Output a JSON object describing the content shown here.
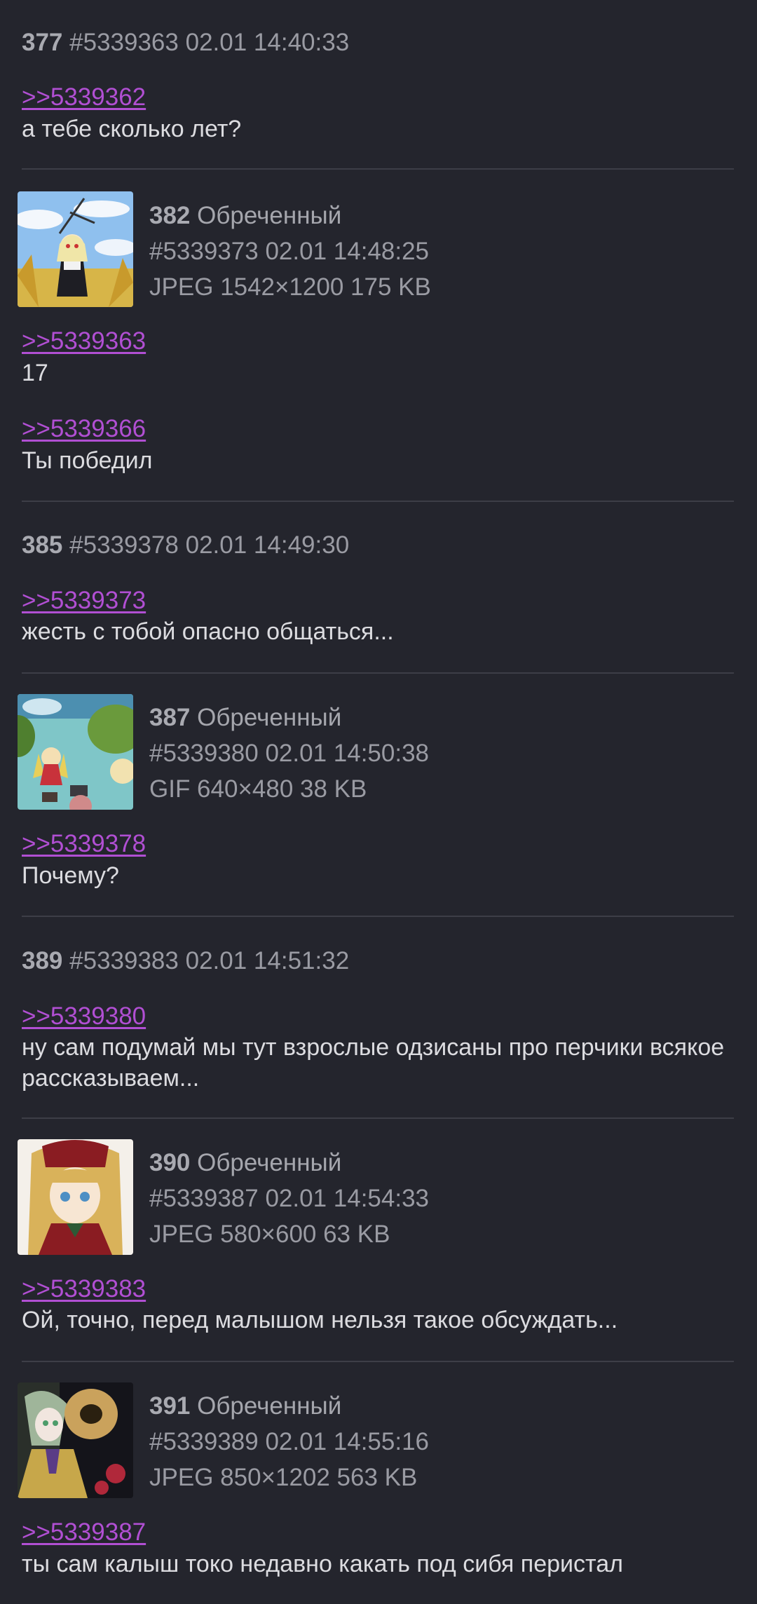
{
  "posts": [
    {
      "num": "377",
      "id": "#5339363",
      "date": "02.01 14:40:33",
      "replies": [
        {
          "link": ">>5339362",
          "text": "а тебе сколько лет?"
        }
      ]
    },
    {
      "num": "382",
      "name": "Обреченный",
      "id": "#5339373",
      "date": "02.01 14:48:25",
      "file": "JPEG 1542×1200 175 KB",
      "replies": [
        {
          "link": ">>5339363",
          "text": "17"
        },
        {
          "link": ">>5339366",
          "text": "Ты победил"
        }
      ]
    },
    {
      "num": "385",
      "id": "#5339378",
      "date": "02.01 14:49:30",
      "replies": [
        {
          "link": ">>5339373",
          "text": "жесть с тобой опасно общаться..."
        }
      ]
    },
    {
      "num": "387",
      "name": "Обреченный",
      "id": "#5339380",
      "date": "02.01 14:50:38",
      "file": "GIF 640×480 38 KB",
      "replies": [
        {
          "link": ">>5339378",
          "text": "Почему?"
        }
      ]
    },
    {
      "num": "389",
      "id": "#5339383",
      "date": "02.01 14:51:32",
      "replies": [
        {
          "link": ">>5339380",
          "text": "ну сам подумай мы тут взрослые одзисаны про перчики всякое рассказываем..."
        }
      ]
    },
    {
      "num": "390",
      "name": "Обреченный",
      "id": "#5339387",
      "date": "02.01 14:54:33",
      "file": "JPEG 580×600 63 KB",
      "replies": [
        {
          "link": ">>5339383",
          "text": "Ой, точно, перед малышом нельзя такое обсуждать..."
        }
      ]
    },
    {
      "num": "391",
      "name": "Обреченный",
      "id": "#5339389",
      "date": "02.01 14:55:16",
      "file": "JPEG 850×1202 563 KB",
      "replies": [
        {
          "link": ">>5339387",
          "text": "ты сам калыш токо недавно какать под сибя перистал"
        }
      ]
    }
  ],
  "colors": {
    "background": "#24252d",
    "reply_link": "#b14fd3",
    "meta_text": "#9a9ba3",
    "body_text": "#dcdce0",
    "divider": "#3d3e47"
  }
}
